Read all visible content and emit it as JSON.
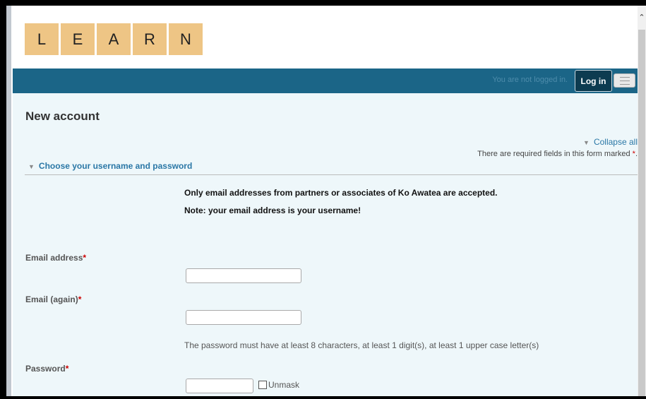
{
  "logo": {
    "letters": [
      "L",
      "E",
      "A",
      "R",
      "N"
    ]
  },
  "navbar": {
    "status": "You are not logged in.",
    "login_label": "Log in",
    "menu_icon": "hamburger-icon"
  },
  "page": {
    "title": "New account",
    "collapse_all": "Collapse all",
    "required_note": "There are required fields in this form marked",
    "required_marker": "*"
  },
  "section": {
    "title": "Choose your username and password",
    "note1": "Only email addresses from partners or associates of Ko Awatea are accepted.",
    "note2": "Note: your email address is your username!"
  },
  "fields": {
    "email": {
      "label": "Email address",
      "value": ""
    },
    "email_again": {
      "label": "Email (again)",
      "value": ""
    },
    "password_rule": "The password must have at least 8 characters, at least 1 digit(s), at least 1 upper case letter(s)",
    "password": {
      "label": "Password",
      "value": "",
      "unmask_label": "Unmask"
    }
  },
  "colors": {
    "navbar": "#1b6587",
    "logo_tile": "#eec585",
    "link": "#2a77a6",
    "required": "#cc0000"
  }
}
